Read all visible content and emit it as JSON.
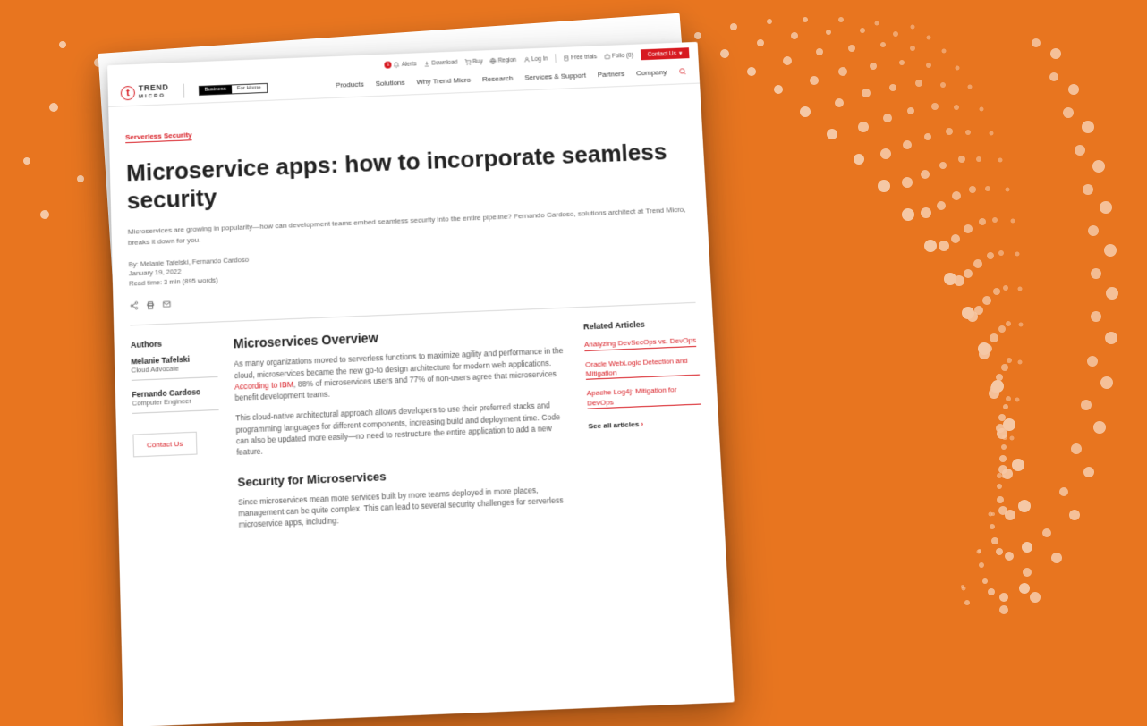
{
  "topbar": {
    "alerts_badge": "1",
    "alerts": "Alerts",
    "download": "Download",
    "buy": "Buy",
    "region": "Region",
    "login": "Log In",
    "freetrials": "Free trials",
    "folio": "Folio (0)",
    "contact": "Contact Us",
    "chev": "▾"
  },
  "logo": {
    "line1": "TREND",
    "line2": "MICRO"
  },
  "segment": {
    "business": "Business",
    "home": "For Home"
  },
  "nav": [
    "Products",
    "Solutions",
    "Why Trend Micro",
    "Research",
    "Services & Support",
    "Partners",
    "Company"
  ],
  "crumb": "Serverless Security",
  "title": "Microservice apps: how to incorporate seamless security",
  "lead": "Microservices are growing in popularity—how can development teams embed seamless security into the entire pipeline? Fernando Cardoso, solutions architect at Trend Micro, breaks it down for you.",
  "byline": {
    "by": "By: Melanie Tafelski, Fernando Cardoso",
    "date": "January 19, 2022",
    "read": "Read time: 3 min (895 words)"
  },
  "left": {
    "heading": "Authors",
    "authors": [
      {
        "name": "Melanie Tafelski",
        "role": "Cloud Advocate"
      },
      {
        "name": "Fernando Cardoso",
        "role": "Computer Engineer"
      }
    ],
    "contact": "Contact Us"
  },
  "mid": {
    "h2a": "Microservices Overview",
    "p1a": "As many organizations moved to serverless functions to maximize agility and performance in the cloud, microservices became the new go-to design architecture for modern web applications. ",
    "p1red": "According to IBM",
    "p1b": ", 88% of microservices users and 77% of non-users agree that microservices benefit development teams.",
    "p2": "This cloud-native architectural approach allows developers to use their preferred stacks and programming languages for different components, increasing build and deployment time. Code can also be updated more easily—no need to restructure the entire application to add a new feature.",
    "h2b": "Security for Microservices",
    "p3": "Since microservices mean more services built by more teams deployed in more places, management can be quite complex. This can lead to several security challenges for serverless microservice apps, including:"
  },
  "right": {
    "heading": "Related Articles",
    "links": [
      "Analyzing DevSecOps vs. DevOps",
      "Oracle WebLogic Detection and Mitigation",
      "Apache Log4j: Mitigation for DevOps"
    ],
    "seeall": "See all articles",
    "chev": "›"
  }
}
